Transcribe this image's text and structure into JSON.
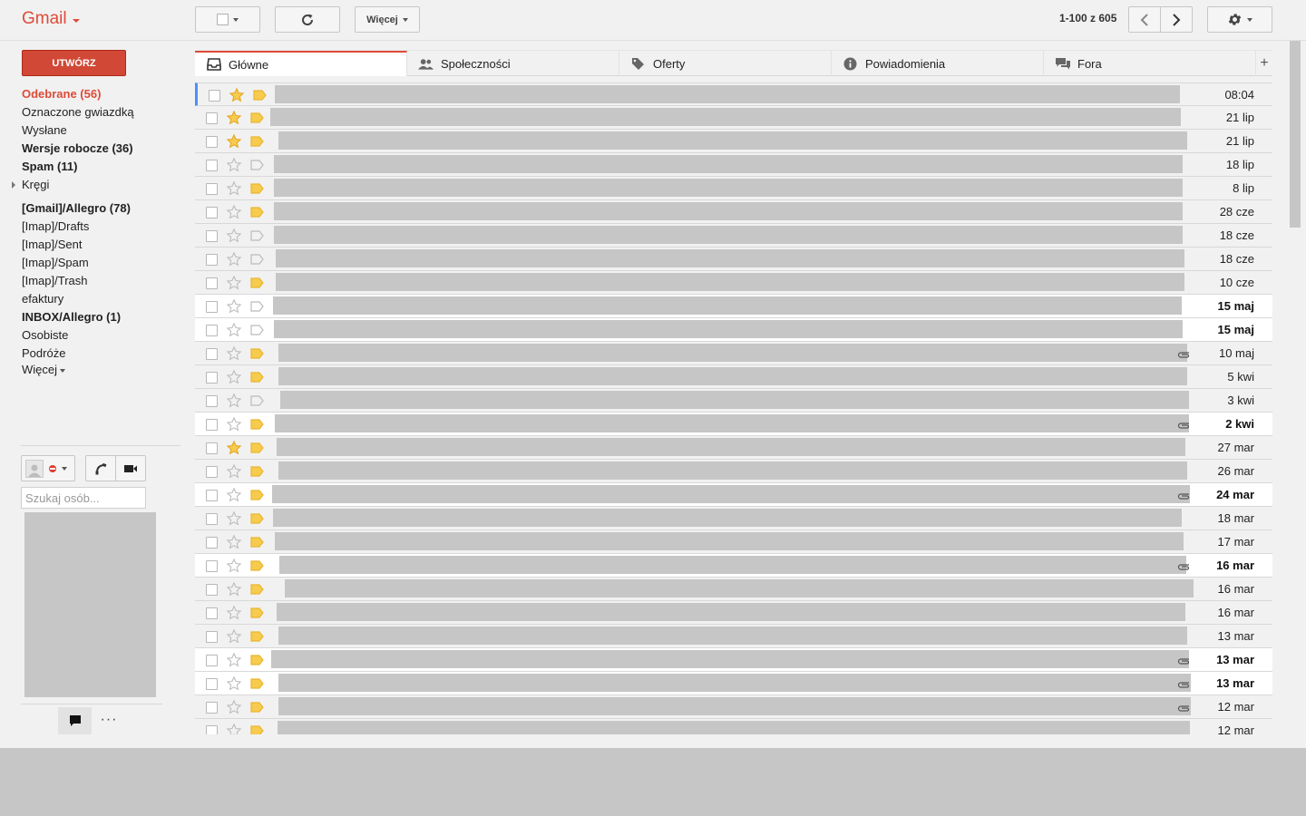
{
  "app": {
    "logo": "Gmail"
  },
  "toolbar": {
    "more_label": "Więcej",
    "pager": "1-100 z 605"
  },
  "sidebar": {
    "compose_label": "UTWÓRZ",
    "items": [
      {
        "label": "Odebrane (56)",
        "style": "active"
      },
      {
        "label": "Oznaczone gwiazdką",
        "style": "normal"
      },
      {
        "label": "Wysłane",
        "style": "normal"
      },
      {
        "label": "Wersje robocze (36)",
        "style": "bold"
      },
      {
        "label": "Spam (11)",
        "style": "bold"
      },
      {
        "label": "Kręgi",
        "style": "normal"
      },
      {
        "label": "[Gmail]/Allegro (78)",
        "style": "bold"
      },
      {
        "label": "[Imap]/Drafts",
        "style": "normal"
      },
      {
        "label": "[Imap]/Sent",
        "style": "normal"
      },
      {
        "label": "[Imap]/Spam",
        "style": "normal"
      },
      {
        "label": "[Imap]/Trash",
        "style": "normal"
      },
      {
        "label": "efaktury",
        "style": "normal"
      },
      {
        "label": "INBOX/Allegro (1)",
        "style": "bold"
      },
      {
        "label": "Osobiste",
        "style": "normal"
      },
      {
        "label": "Podróże",
        "style": "normal"
      },
      {
        "label": "Więcej",
        "style": "normal"
      }
    ]
  },
  "chat": {
    "search_placeholder": "Szukaj osób...",
    "more_dots": "···"
  },
  "tabs": [
    {
      "label": "Główne",
      "icon": "inbox-icon"
    },
    {
      "label": "Społeczności",
      "icon": "people-icon"
    },
    {
      "label": "Oferty",
      "icon": "tag-icon"
    },
    {
      "label": "Powiadomienia",
      "icon": "info-icon"
    },
    {
      "label": "Fora",
      "icon": "forum-icon"
    }
  ],
  "tab_add": "+",
  "colors": {
    "accent": "#dd4b39",
    "compose": "#d14836",
    "star": "#f7cb4d",
    "label_yellow": "#f7cb4d",
    "redacted": "#c6c6c6",
    "selection": "#4d90fe"
  },
  "messages": [
    {
      "date": "08:04",
      "starred": true,
      "important": true,
      "unread": false,
      "attachment": false
    },
    {
      "date": "21 lip",
      "starred": true,
      "important": true,
      "unread": false,
      "attachment": false
    },
    {
      "date": "21 lip",
      "starred": true,
      "important": true,
      "unread": false,
      "attachment": false
    },
    {
      "date": "18 lip",
      "starred": false,
      "important": false,
      "unread": false,
      "attachment": false
    },
    {
      "date": "8 lip",
      "starred": false,
      "important": true,
      "unread": false,
      "attachment": false
    },
    {
      "date": "28 cze",
      "starred": false,
      "important": true,
      "unread": false,
      "attachment": false
    },
    {
      "date": "18 cze",
      "starred": false,
      "important": false,
      "unread": false,
      "attachment": false
    },
    {
      "date": "18 cze",
      "starred": false,
      "important": false,
      "unread": false,
      "attachment": false
    },
    {
      "date": "10 cze",
      "starred": false,
      "important": true,
      "unread": false,
      "attachment": false
    },
    {
      "date": "15 maj",
      "starred": false,
      "important": false,
      "unread": true,
      "attachment": false
    },
    {
      "date": "15 maj",
      "starred": false,
      "important": false,
      "unread": true,
      "attachment": false
    },
    {
      "date": "10 maj",
      "starred": false,
      "important": true,
      "unread": false,
      "attachment": true
    },
    {
      "date": "5 kwi",
      "starred": false,
      "important": true,
      "unread": false,
      "attachment": false
    },
    {
      "date": "3 kwi",
      "starred": false,
      "important": false,
      "unread": false,
      "attachment": false
    },
    {
      "date": "2 kwi",
      "starred": false,
      "important": true,
      "unread": true,
      "attachment": true
    },
    {
      "date": "27 mar",
      "starred": true,
      "important": true,
      "unread": false,
      "attachment": false
    },
    {
      "date": "26 mar",
      "starred": false,
      "important": true,
      "unread": false,
      "attachment": false
    },
    {
      "date": "24 mar",
      "starred": false,
      "important": true,
      "unread": true,
      "attachment": true
    },
    {
      "date": "18 mar",
      "starred": false,
      "important": true,
      "unread": false,
      "attachment": false
    },
    {
      "date": "17 mar",
      "starred": false,
      "important": true,
      "unread": false,
      "attachment": false
    },
    {
      "date": "16 mar",
      "starred": false,
      "important": true,
      "unread": true,
      "attachment": true
    },
    {
      "date": "16 mar",
      "starred": false,
      "important": true,
      "unread": false,
      "attachment": false
    },
    {
      "date": "16 mar",
      "starred": false,
      "important": true,
      "unread": false,
      "attachment": false
    },
    {
      "date": "13 mar",
      "starred": false,
      "important": true,
      "unread": false,
      "attachment": false
    },
    {
      "date": "13 mar",
      "starred": false,
      "important": true,
      "unread": true,
      "attachment": true
    },
    {
      "date": "13 mar",
      "starred": false,
      "important": true,
      "unread": true,
      "attachment": true
    },
    {
      "date": "12 mar",
      "starred": false,
      "important": true,
      "unread": false,
      "attachment": true
    },
    {
      "date": "12 mar",
      "starred": false,
      "important": true,
      "unread": false,
      "attachment": false
    }
  ]
}
